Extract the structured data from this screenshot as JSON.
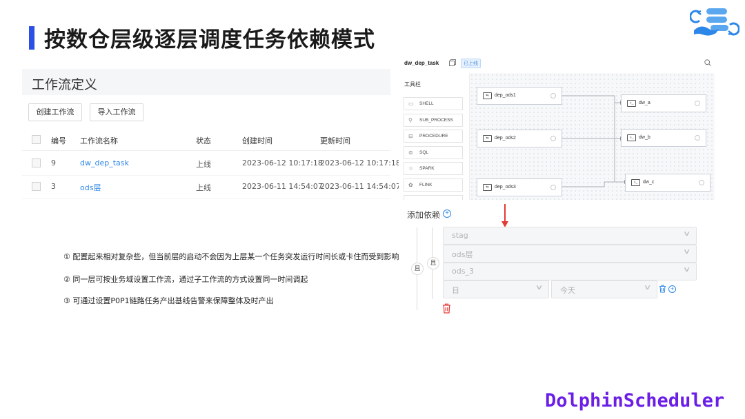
{
  "slide": {
    "title": "按数仓层级逐层调度任务依赖模式",
    "brand": "DolphinScheduler"
  },
  "workflow": {
    "panel_title": "工作流定义",
    "create_button": "创建工作流",
    "import_button": "导入工作流",
    "columns": [
      "编号",
      "工作流名称",
      "状态",
      "创建时间",
      "更新时间"
    ],
    "rows": [
      {
        "id": "9",
        "name": "dw_dep_task",
        "status": "上线",
        "created": "2023-06-12 10:17:18",
        "updated": "2023-06-12 10:17:18"
      },
      {
        "id": "3",
        "name": "ods层",
        "status": "上线",
        "created": "2023-06-11 14:54:07",
        "updated": "2023-06-11 14:54:07"
      }
    ]
  },
  "notes": [
    "① 配置起来相对复杂些，但当前层的启动不会因为上层某一个任务突发运行时间长或卡住而受到影响",
    "② 同一层可按业务域设置工作流，通过子工作流的方式设置同一时间调起",
    "③ 可通过设置P0P1链路任务产出基线告警来保障整体及时产出"
  ],
  "dag": {
    "workflow_name": "dw_dep_task",
    "status_badge": "已上线",
    "toolbox_title": "工具栏",
    "tools": [
      {
        "icon": "shell-icon",
        "label": "SHELL"
      },
      {
        "icon": "sub-process-icon",
        "label": "SUB_PROCESS"
      },
      {
        "icon": "procedure-icon",
        "label": "PROCEDURE"
      },
      {
        "icon": "sql-icon",
        "label": "SQL"
      },
      {
        "icon": "spark-icon",
        "label": "SPARK"
      },
      {
        "icon": "flink-icon",
        "label": "FLINK"
      }
    ],
    "nodes": {
      "dep_ods1": "dep_ods1",
      "dep_ods2": "dep_ods2",
      "dep_ods3": "dep_ods3",
      "dw_a": "dw_a",
      "dw_b": "dw_b",
      "dw_c": "dw_c"
    }
  },
  "dependency": {
    "title": "添加依赖",
    "and_outer": "且",
    "and_inner": "且",
    "selects": {
      "project": "stag",
      "workflow": "ods层",
      "task": "ods_3",
      "cycle": "日",
      "date": "今天"
    }
  },
  "colors": {
    "accent": "#2b50e6",
    "link": "#2d87e8",
    "brand": "#6b1ee6",
    "arrow": "#e53935",
    "delete": "#e53935"
  }
}
